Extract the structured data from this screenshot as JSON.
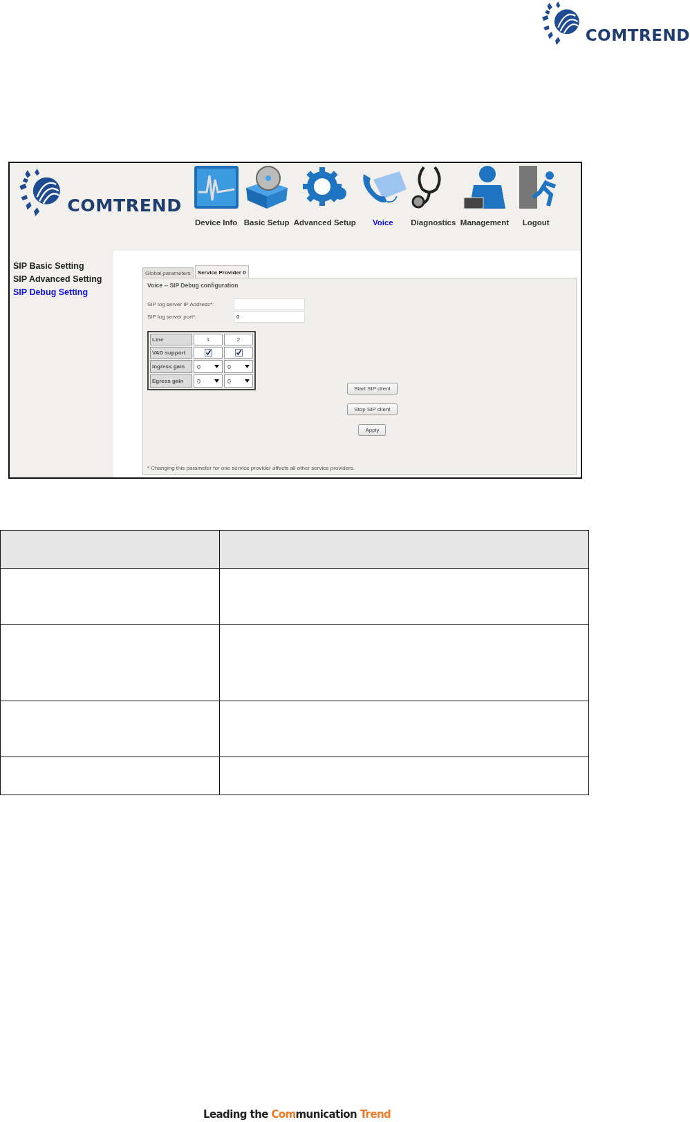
{
  "page_logo": {
    "brand": "COMTREND"
  },
  "screenshot": {
    "logo": {
      "brand": "COMTREND"
    },
    "nav": [
      {
        "kind": "device",
        "label": "Device Info",
        "selected": false
      },
      {
        "kind": "basic",
        "label": "Basic Setup",
        "selected": false
      },
      {
        "kind": "advanced",
        "label": "Advanced Setup",
        "selected": false
      },
      {
        "kind": "voice",
        "label": "Voice",
        "selected": true
      },
      {
        "kind": "diagnostics",
        "label": "Diagnostics",
        "selected": false
      },
      {
        "kind": "management",
        "label": "Management",
        "selected": false
      },
      {
        "kind": "logout",
        "label": "Logout",
        "selected": false
      }
    ],
    "sidebar": {
      "items": [
        {
          "label": "SIP Basic Setting",
          "selected": false
        },
        {
          "label": "SIP Advanced Setting",
          "selected": false
        },
        {
          "label": "SIP Debug Setting",
          "selected": true
        }
      ]
    },
    "tabs": [
      {
        "label": "Global parameters",
        "selected": false
      },
      {
        "label": "Service Provider 0",
        "selected": true
      }
    ],
    "section_title": "Voice -- SIP Debug configuration",
    "fields": [
      {
        "label": "SIP log server IP Address*:"
      },
      {
        "label": "SIP log server port*:",
        "value": "0"
      }
    ],
    "line_table": {
      "header": "Line",
      "lines": [
        "1",
        "2"
      ],
      "rows": [
        {
          "kind": "checkbox",
          "label": "VAD support",
          "cells": [
            {
              "checked": true
            },
            {
              "checked": true
            }
          ]
        },
        {
          "kind": "select",
          "label": "Ingress gain",
          "cells": [
            {
              "value": "0"
            },
            {
              "value": "0"
            }
          ]
        },
        {
          "kind": "select",
          "label": "Egress gain",
          "cells": [
            {
              "value": "0"
            },
            {
              "value": "0"
            }
          ]
        }
      ]
    },
    "buttons": [
      "Start SIP client",
      "Stop SIP client",
      "Apply"
    ],
    "footnote": "* Changing this parameter for one service provider affects all other service providers."
  },
  "footer": {
    "parts": [
      {
        "text": "Leading the ",
        "accent": false
      },
      {
        "text": "Com",
        "accent": true
      },
      {
        "text": "munication ",
        "accent": false
      },
      {
        "text": "Trend",
        "accent": true
      }
    ]
  }
}
